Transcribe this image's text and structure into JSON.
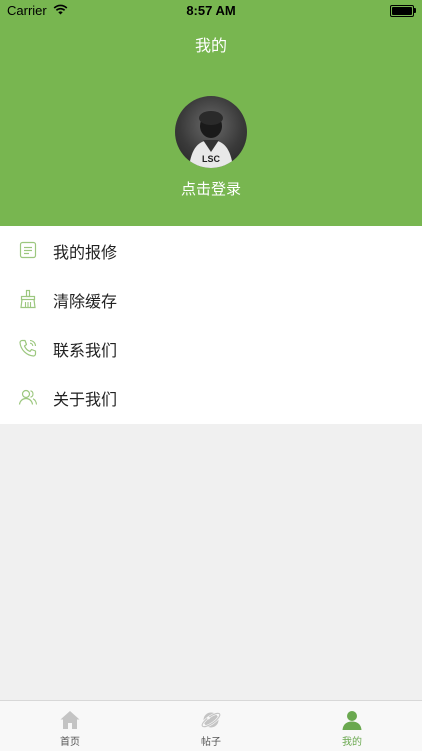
{
  "status_bar": {
    "carrier": "Carrier",
    "time": "8:57 AM"
  },
  "header": {
    "title": "我的",
    "login_prompt": "点击登录"
  },
  "menu": {
    "items": [
      {
        "label": "我的报修",
        "icon": "repair-list-icon"
      },
      {
        "label": "清除缓存",
        "icon": "broom-icon"
      },
      {
        "label": "联系我们",
        "icon": "phone-icon"
      },
      {
        "label": "关于我们",
        "icon": "users-icon"
      }
    ]
  },
  "tabbar": {
    "tabs": [
      {
        "label": "首页",
        "icon": "home-icon"
      },
      {
        "label": "帖子",
        "icon": "planet-icon"
      },
      {
        "label": "我的",
        "icon": "person-icon"
      }
    ],
    "active_index": 2
  },
  "colors": {
    "accent": "#78b650",
    "active_tab": "#6aa84f",
    "background": "#f0f0f0"
  }
}
